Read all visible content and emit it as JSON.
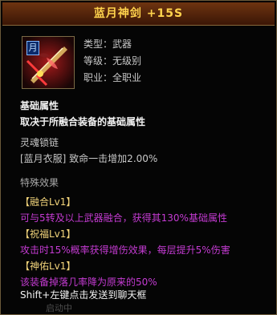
{
  "title": "蓝月神剑 +15S",
  "badge": "月",
  "info": [
    {
      "text": "类型：武器"
    },
    {
      "text": "等级：无级别"
    },
    {
      "text": "职业：全职业"
    }
  ],
  "base_title": "基础属性",
  "base_text": "取决于所融合装备的基础属性",
  "soul_title": "灵魂锁链",
  "soul_text": "[蓝月衣服] 致命一击增加2.00%",
  "special_title": "特殊效果",
  "effects": [
    {
      "name": "【融合Lv1】",
      "desc": "可与5转及以上武器融合，获得其130%基础属性"
    },
    {
      "name": "【祝福Lv1】",
      "desc": "攻击时15%概率获得增伤效果，每层提升5%伤害"
    },
    {
      "name": "【神佑Lv1】",
      "desc": "该装备掉落几率降为原来的50%"
    }
  ],
  "hint": "Shift+左键点击发送到聊天框",
  "bottom_text": "启动中"
}
